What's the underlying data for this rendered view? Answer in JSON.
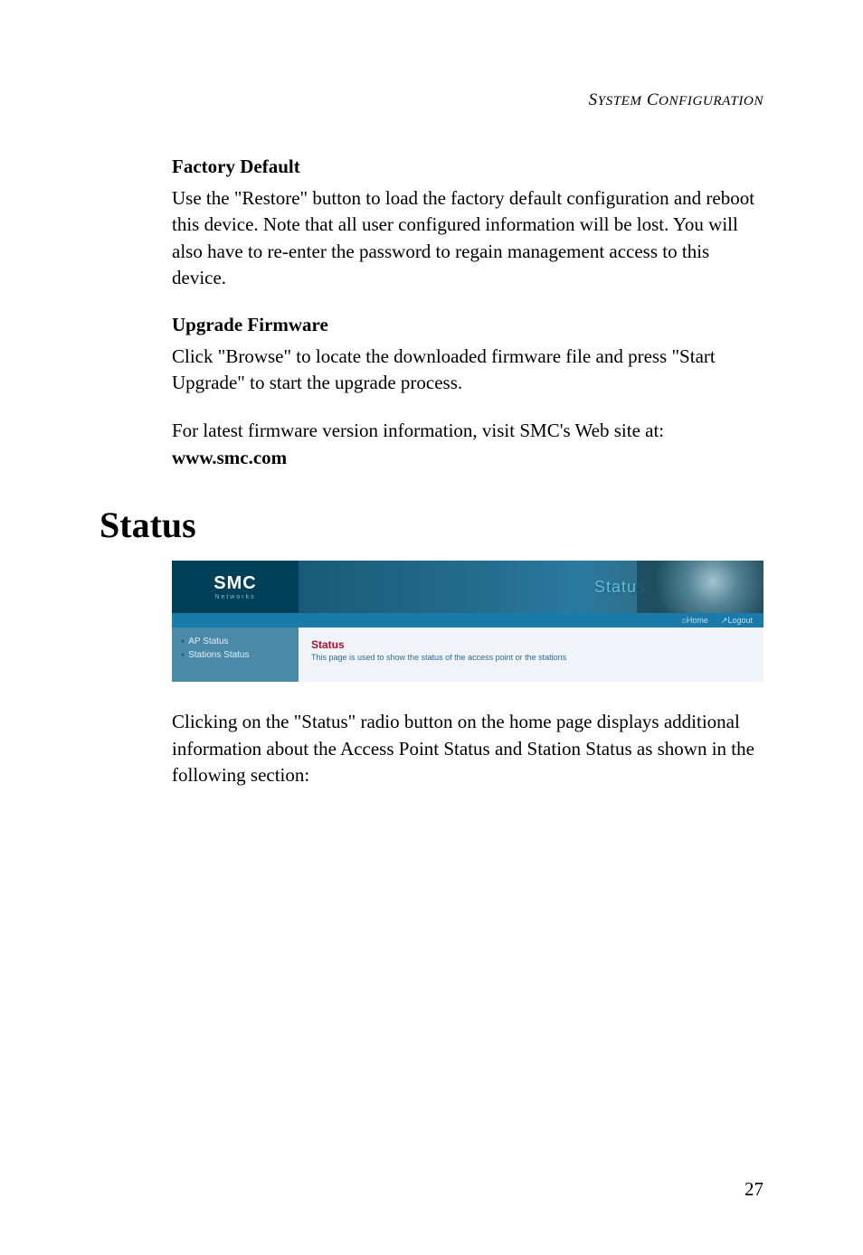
{
  "header": {
    "title_small1": "S",
    "title_rest1": "YSTEM",
    "title_small2": "C",
    "title_rest2": "ONFIGURATION"
  },
  "section_factory": {
    "heading": "Factory Default",
    "body": "Use the \"Restore\" button to load the factory default configuration and reboot this device. Note that all user configured information will be lost. You will also have to re-enter the password to regain management access to this device."
  },
  "section_upgrade": {
    "heading": "Upgrade Firmware",
    "body1": "Click \"Browse\" to locate the downloaded firmware file and press \"Start Upgrade\" to start the upgrade process.",
    "body2": "For latest firmware version information, visit SMC's Web site at:",
    "link": "www.smc.com"
  },
  "main_heading": "Status",
  "screenshot": {
    "logo": "SMC",
    "logo_sub": "Networks",
    "banner_text": "Status",
    "ribbon_home": "Home",
    "ribbon_logout": "Logout",
    "sidebar_items": [
      "AP Status",
      "Stations Status"
    ],
    "main_title": "Status",
    "main_desc": "This page is used to show the status of the access point or the stations"
  },
  "closing_text": "Clicking on the \"Status\" radio button on the home page displays additional information about the Access Point Status and Station Status as shown in the following section:",
  "page_number": "27"
}
